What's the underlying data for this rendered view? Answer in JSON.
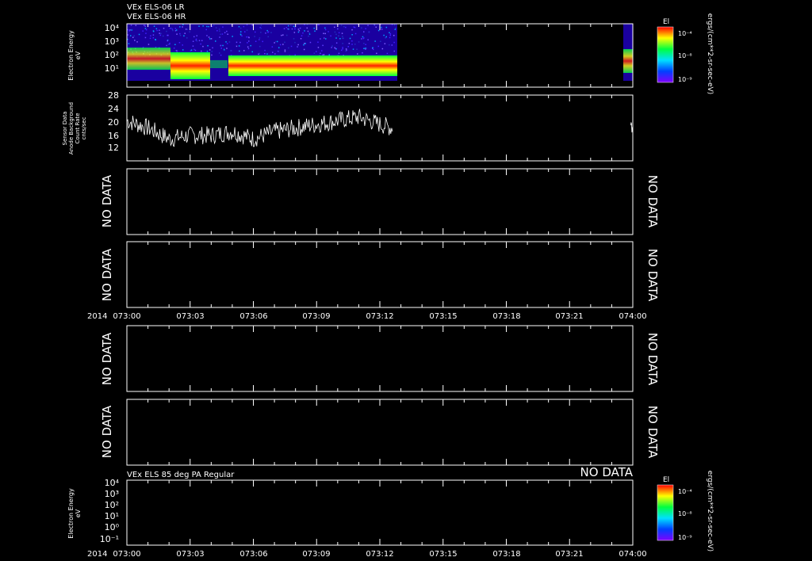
{
  "figure": {
    "titles_top": [
      "VEx ELS-06 LR",
      "VEx ELS-06 HR"
    ],
    "title_bottom": "VEx ELS 85 deg PA Regular",
    "no_data_label": "NO DATA",
    "time_axis": {
      "year_label": "2014",
      "ticks": [
        "073:00",
        "073:03",
        "073:06",
        "073:09",
        "073:12",
        "073:15",
        "073:18",
        "073:21",
        "074:00"
      ]
    }
  },
  "colorbars": [
    {
      "label": "El",
      "unit": "ergs/(cm**2-sr-sec-eV)",
      "ticks": [
        "10⁻⁴",
        "10⁻⁸",
        "10⁻⁹"
      ]
    },
    {
      "label": "El",
      "unit": "ergs/(cm**2-sr-sec-eV)",
      "ticks": [
        "10⁻⁴",
        "10⁻⁸",
        "10⁻⁹"
      ]
    }
  ],
  "chart_data": [
    {
      "type": "heatmap",
      "title": "VEx ELS-06 LR / VEx ELS-06 HR",
      "ylabel": "Electron Energy eV",
      "yscale": "log",
      "ylim": [
        1,
        10000
      ],
      "y_ticks": [
        "10¹",
        "10²",
        "10³",
        "10⁴"
      ],
      "coverage_minutes": [
        [
          0,
          12.6
        ],
        [
          23.9,
          24
        ]
      ],
      "bands": [
        {
          "t": [
            0,
            2.0
          ],
          "center_eV": 25,
          "note": "broad green band"
        },
        {
          "t": [
            2.0,
            3.8
          ],
          "center_eV": 12,
          "note": "disturbed, yellow/red"
        },
        {
          "t": [
            4.7,
            12.6
          ],
          "center_eV": 12,
          "note": "red core band"
        }
      ]
    },
    {
      "type": "line",
      "ylabel": "Sensor Data Anode Background Count Rate cnts/sec",
      "ylim": [
        10,
        28
      ],
      "y_ticks": [
        "12",
        "16",
        "20",
        "24",
        "28"
      ],
      "x_minutes": [
        0,
        1,
        2,
        3,
        4,
        5,
        6,
        7,
        8,
        9,
        10,
        11,
        12,
        12.6,
        23.9,
        24
      ],
      "values": [
        21,
        19,
        16,
        17,
        17,
        18,
        16,
        18,
        19,
        20,
        21,
        22,
        20,
        19,
        21,
        18
      ]
    },
    {
      "type": "line",
      "values": [],
      "status": "NO DATA"
    },
    {
      "type": "line",
      "values": [],
      "status": "NO DATA"
    },
    {
      "type": "line",
      "values": [],
      "status": "NO DATA"
    },
    {
      "type": "line",
      "values": [],
      "status": "NO DATA"
    },
    {
      "type": "heatmap",
      "title": "VEx ELS 85 deg PA Regular",
      "ylabel": "Electron Energy eV",
      "yscale": "log",
      "ylim": [
        0.1,
        10000
      ],
      "y_ticks": [
        "10⁻¹",
        "10⁰",
        "10¹",
        "10²",
        "10³",
        "10⁴"
      ],
      "status": "NO DATA"
    }
  ]
}
